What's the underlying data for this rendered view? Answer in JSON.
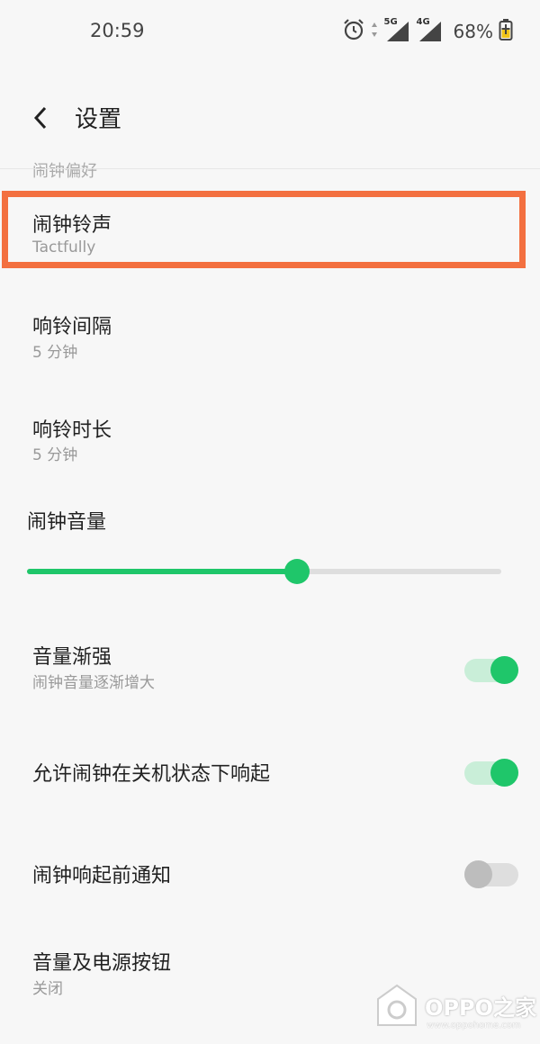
{
  "status_bar": {
    "time": "20:59",
    "net_5g": "5G",
    "net_4g": "4G",
    "battery": "68%"
  },
  "header": {
    "title": "设置"
  },
  "partial_item": "闹钟偏好",
  "items": [
    {
      "title": "闹钟铃声",
      "subtitle": "Tactfully"
    },
    {
      "title": "响铃间隔",
      "subtitle": "5 分钟"
    },
    {
      "title": "响铃时长",
      "subtitle": "5 分钟"
    }
  ],
  "volume": {
    "title": "闹钟音量",
    "level": 0.57
  },
  "toggles": [
    {
      "title": "音量渐强",
      "subtitle": "闹钟音量逐渐增大",
      "on": true
    },
    {
      "title": "允许闹钟在关机状态下响起",
      "on": true
    },
    {
      "title": "闹钟响起前通知",
      "on": false
    }
  ],
  "last_item": {
    "title": "音量及电源按钮",
    "subtitle": "关闭"
  },
  "watermark": {
    "text": "OPPO之家",
    "sub": "www.oppohome.com"
  },
  "colors": {
    "accent": "#1fc66a",
    "highlight": "#f37040"
  }
}
